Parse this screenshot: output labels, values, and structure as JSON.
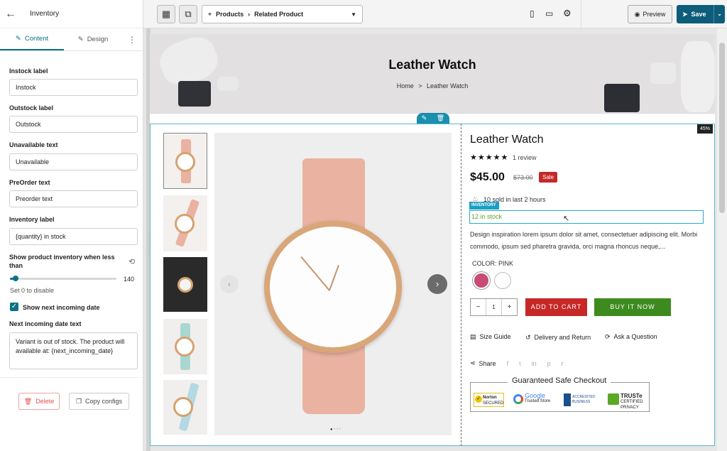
{
  "panel": {
    "title": "Inventory",
    "tabs": {
      "content": "Content",
      "design": "Design"
    },
    "fields": {
      "instock_label": "Instock label",
      "instock_value": "Instock",
      "outstock_label": "Outstock label",
      "outstock_value": "Outstock",
      "unavailable_label": "Unavailable text",
      "unavailable_value": "Unavailable",
      "preorder_label": "PreOrder text",
      "preorder_value": "Preorder text",
      "inventory_label": "Inventory label",
      "inventory_value": "{quantity} in stock",
      "threshold_label": "Show product inventory when less than",
      "threshold_value": "140",
      "threshold_fraction": 0.05,
      "threshold_hint": "Set 0 to disable",
      "show_next_label": "Show next incoming date",
      "show_next_checked": true,
      "next_text_label": "Next incoming date text",
      "next_text_value": "Variant is out of stock. The product will available at: {next_incoming_date}"
    },
    "delete_label": "Delete",
    "copy_label": "Copy configs"
  },
  "topbar": {
    "page_path": "Products",
    "page_name": "Related Product",
    "preview_label": "Preview",
    "save_label": "Save"
  },
  "page": {
    "hero_title": "Leather Watch",
    "breadcrumb_home": "Home",
    "breadcrumb_sep": ">",
    "breadcrumb_current": "Leather Watch",
    "discount_badge": "45%",
    "product_title": "Leather Watch",
    "rating_stars": "★★★★★",
    "review_text": "1 review",
    "price": "$45.00",
    "compare_price": "$73.00",
    "sale_badge": "Sale",
    "sold_text": "10 sold in last 2 hours",
    "inventory_tag": "INVENTORY",
    "stock_text": "12 in stock",
    "description": "Design inspiration lorem ipsum dolor sit amet, consectetuer adipiscing elit. Morbi commodo, ipsum sed pharetra gravida, orci magna rhoncus neque,...",
    "color_label": "COLOR: PINK",
    "qty_minus": "−",
    "qty_value": "1",
    "qty_plus": "+",
    "add_to_cart": "ADD TO CART",
    "buy_now": "BUY IT NOW",
    "size_guide": "Size Guide",
    "delivery": "Delivery and Return",
    "ask_question": "Ask a Question",
    "share": "Share",
    "safe_checkout": "Guaranteed Safe Checkout",
    "badges": {
      "norton": "Norton",
      "norton_sub": "SECURED",
      "google": "Google",
      "google_sub": "Trusted Store",
      "bbb": "ACCREDITED BUSINESS",
      "truste": "TRUSTe",
      "truste_sub": "CERTIFIED PRIVACY"
    }
  },
  "colors": {
    "accent": "#0b7285",
    "sale": "#c62828",
    "buy": "#3d8b1e",
    "save": "#0d5d7a"
  }
}
